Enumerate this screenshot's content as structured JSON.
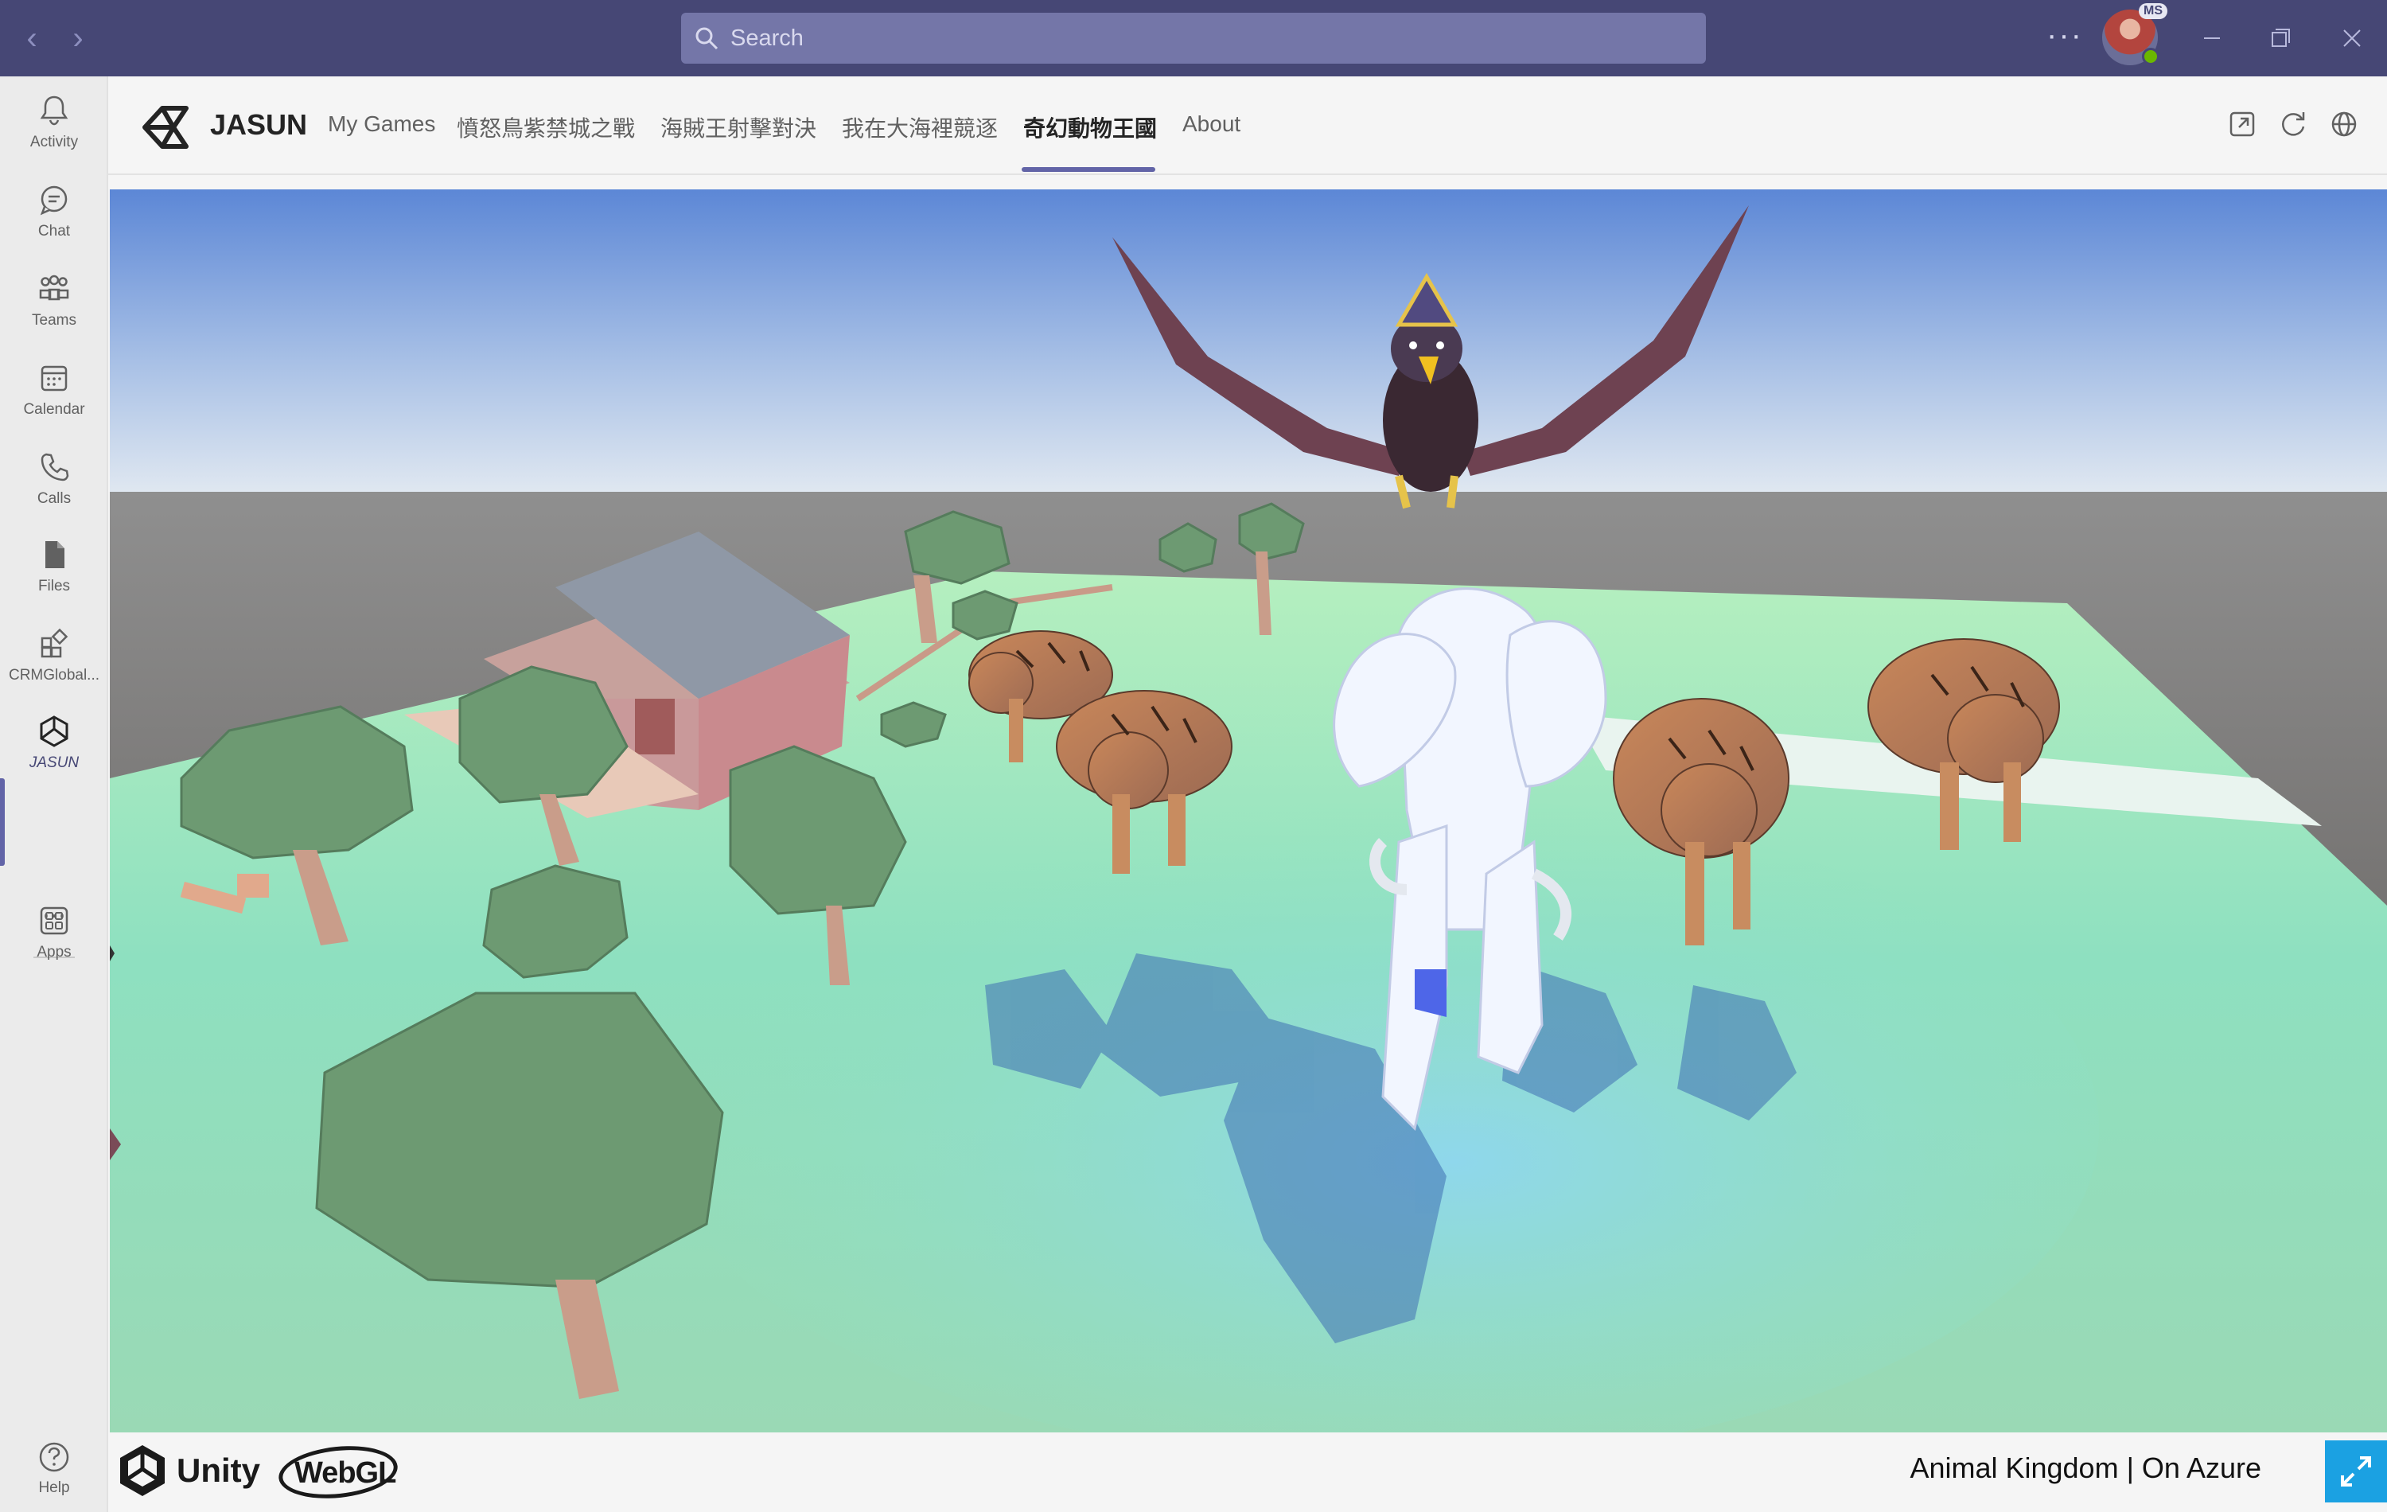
{
  "titlebar": {
    "search_placeholder": "Search",
    "avatar_badge": "MS"
  },
  "rail": {
    "items": [
      {
        "label": "Activity",
        "icon": "bell-icon"
      },
      {
        "label": "Chat",
        "icon": "chat-icon"
      },
      {
        "label": "Teams",
        "icon": "teams-icon"
      },
      {
        "label": "Calendar",
        "icon": "calendar-icon"
      },
      {
        "label": "Calls",
        "icon": "phone-icon"
      },
      {
        "label": "Files",
        "icon": "file-icon"
      },
      {
        "label": "CRMGlobal...",
        "icon": "app-grid-plus-icon"
      },
      {
        "label": "JASUN",
        "icon": "unity-icon",
        "active": true
      }
    ],
    "more": "...",
    "apps_label": "Apps",
    "help_label": "Help"
  },
  "app": {
    "name": "JASUN",
    "tabs": [
      {
        "label": "My Games"
      },
      {
        "label": "憤怒鳥紫禁城之戰"
      },
      {
        "label": "海賊王射擊對決"
      },
      {
        "label": "我在大海裡競逐"
      },
      {
        "label": "奇幻動物王國",
        "active": true
      },
      {
        "label": "About"
      }
    ],
    "header_icons": [
      "popout-icon",
      "refresh-icon",
      "globe-icon"
    ]
  },
  "footer": {
    "unity_text": "Unity",
    "webgl_text": "WebGL",
    "game_title": "Animal Kingdom | On Azure"
  },
  "colors": {
    "titlebar": "#464775",
    "accent": "#6264a7",
    "fullscreen_button": "#1ba1e2"
  }
}
